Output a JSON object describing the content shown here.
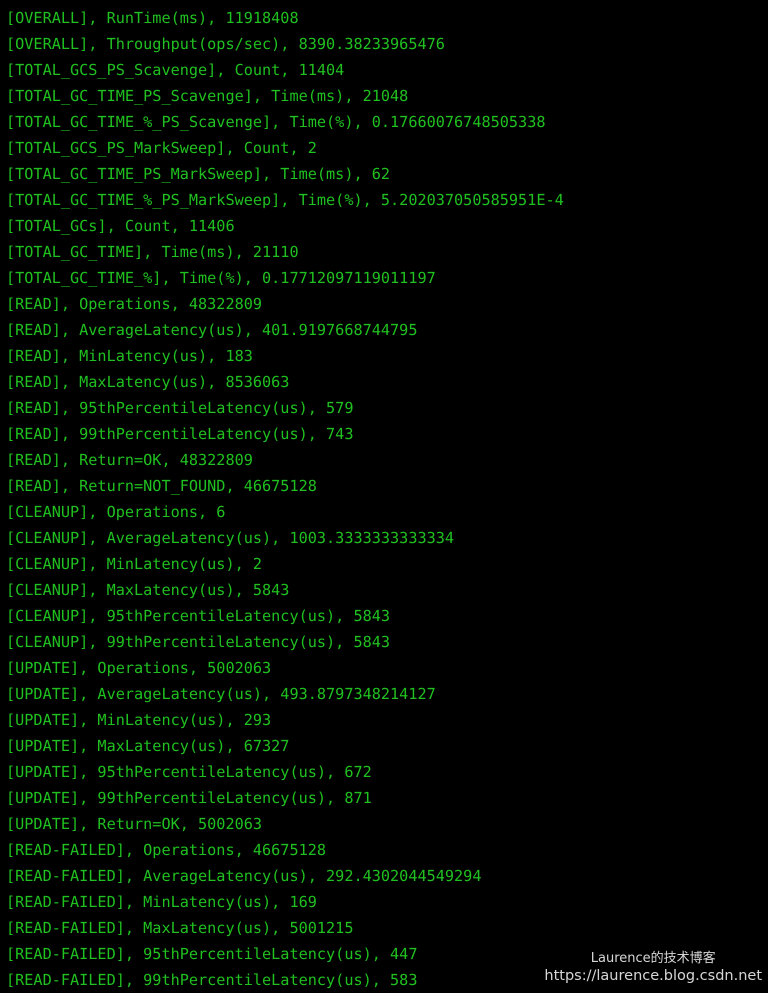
{
  "terminal": {
    "background_color": "#000000",
    "text_color": "#20c020",
    "lines": [
      "[OVERALL], RunTime(ms), 11918408",
      "[OVERALL], Throughput(ops/sec), 8390.38233965476",
      "[TOTAL_GCS_PS_Scavenge], Count, 11404",
      "[TOTAL_GC_TIME_PS_Scavenge], Time(ms), 21048",
      "[TOTAL_GC_TIME_%_PS_Scavenge], Time(%), 0.17660076748505338",
      "[TOTAL_GCS_PS_MarkSweep], Count, 2",
      "[TOTAL_GC_TIME_PS_MarkSweep], Time(ms), 62",
      "[TOTAL_GC_TIME_%_PS_MarkSweep], Time(%), 5.202037050585951E-4",
      "[TOTAL_GCs], Count, 11406",
      "[TOTAL_GC_TIME], Time(ms), 21110",
      "[TOTAL_GC_TIME_%], Time(%), 0.17712097119011197",
      "[READ], Operations, 48322809",
      "[READ], AverageLatency(us), 401.9197668744795",
      "[READ], MinLatency(us), 183",
      "[READ], MaxLatency(us), 8536063",
      "[READ], 95thPercentileLatency(us), 579",
      "[READ], 99thPercentileLatency(us), 743",
      "[READ], Return=OK, 48322809",
      "[READ], Return=NOT_FOUND, 46675128",
      "[CLEANUP], Operations, 6",
      "[CLEANUP], AverageLatency(us), 1003.3333333333334",
      "[CLEANUP], MinLatency(us), 2",
      "[CLEANUP], MaxLatency(us), 5843",
      "[CLEANUP], 95thPercentileLatency(us), 5843",
      "[CLEANUP], 99thPercentileLatency(us), 5843",
      "[UPDATE], Operations, 5002063",
      "[UPDATE], AverageLatency(us), 493.8797348214127",
      "[UPDATE], MinLatency(us), 293",
      "[UPDATE], MaxLatency(us), 67327",
      "[UPDATE], 95thPercentileLatency(us), 672",
      "[UPDATE], 99thPercentileLatency(us), 871",
      "[UPDATE], Return=OK, 5002063",
      "[READ-FAILED], Operations, 46675128",
      "[READ-FAILED], AverageLatency(us), 292.4302044549294",
      "[READ-FAILED], MinLatency(us), 169",
      "[READ-FAILED], MaxLatency(us), 5001215",
      "[READ-FAILED], 95thPercentileLatency(us), 447",
      "[READ-FAILED], 99thPercentileLatency(us), 583"
    ]
  },
  "watermark": {
    "line1": "Laurence的技术博客",
    "line2": "https://laurence.blog.csdn.net",
    "color": "#e8e8e8"
  }
}
